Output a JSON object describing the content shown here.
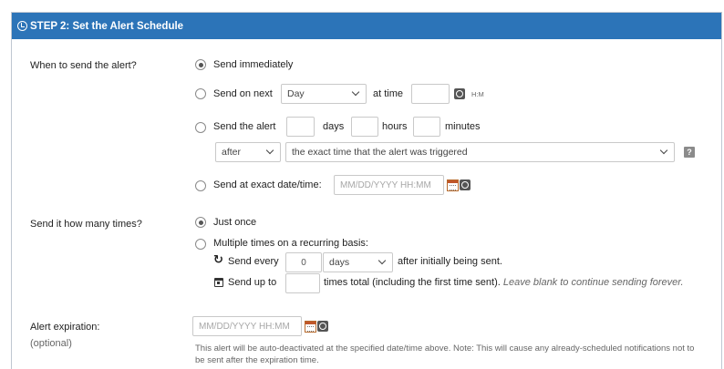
{
  "header": {
    "title": "STEP 2: Set the Alert Schedule"
  },
  "when": {
    "label": "When to send the alert?",
    "immediately": "Send immediately",
    "next_label": "Send on next",
    "next_unit": "Day",
    "at_time": "at time",
    "time_value": "",
    "hm": "H:M",
    "relative_label": "Send the alert",
    "days_value": "",
    "days": "days",
    "hours_value": "",
    "hours": "hours",
    "minutes_value": "",
    "minutes": "minutes",
    "when_relation": "after",
    "relative_to": "the exact time that the alert was triggered",
    "help": "?",
    "exact_label": "Send at exact date/time:",
    "exact_placeholder": "MM/DD/YYYY HH:MM"
  },
  "times": {
    "label": "Send it how many times?",
    "once": "Just once",
    "multiple": "Multiple times on a recurring basis:",
    "every_label": "Send every",
    "every_value": "0",
    "every_unit": "days",
    "after_sent": "after initially being sent.",
    "upto_label": "Send up to",
    "upto_value": "",
    "times_total": "times total (including the first time sent).",
    "forever_hint": "Leave blank to continue sending forever."
  },
  "expiration": {
    "label": "Alert expiration:",
    "optional": "(optional)",
    "placeholder": "MM/DD/YYYY HH:MM",
    "note": "This alert will be auto-deactivated at the specified date/time above. Note: This will cause any already-scheduled notifications not to be sent after the expiration time."
  }
}
